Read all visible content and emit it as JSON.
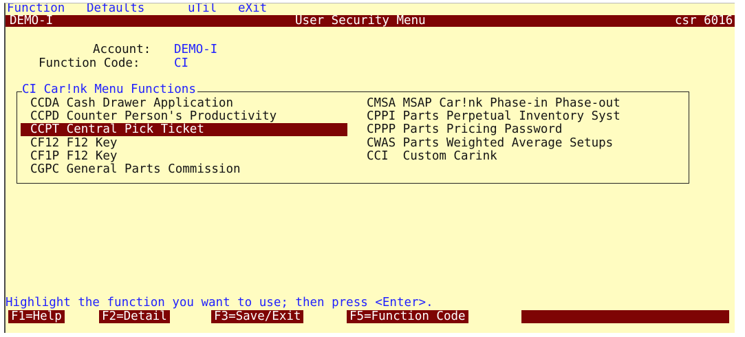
{
  "menubar": {
    "items": [
      "Function",
      "Defaults",
      "uTil",
      "eXit"
    ]
  },
  "titlebar": {
    "left": "DEMO-I",
    "title": "User Security Menu",
    "right": "csr 6016"
  },
  "form": {
    "account_label": "Account:",
    "account_value": "DEMO-I",
    "function_code_label": "Function Code:",
    "function_code_value": "CI"
  },
  "box": {
    "title": "CI Car!nk Menu Functions",
    "left_items": [
      "CCDA Cash Drawer Application",
      "CCPD Counter Person's Productivity",
      "CCPT Central Pick Ticket",
      "CF12 F12 Key",
      "CF1P F12 Key",
      "CGPC General Parts Commission"
    ],
    "right_items": [
      "CMSA MSAP Car!nk Phase-in Phase-out",
      "CPPI Parts Perpetual Inventory Syst",
      "CPPP Parts Pricing Password",
      "CWAS Parts Weighted Average Setups",
      "CCI  Custom Carink"
    ],
    "selected": "CCPT Central Pick Ticket"
  },
  "status": {
    "message": "Highlight the function you want to use; then press <Enter>."
  },
  "fkeys": [
    "F1=Help",
    "F2=Detail",
    "F3=Save/Exit",
    "F5=Function Code"
  ],
  "colors": {
    "background": "#fffcc1",
    "bar": "#7e0404",
    "text_blue": "#1f1fff"
  }
}
